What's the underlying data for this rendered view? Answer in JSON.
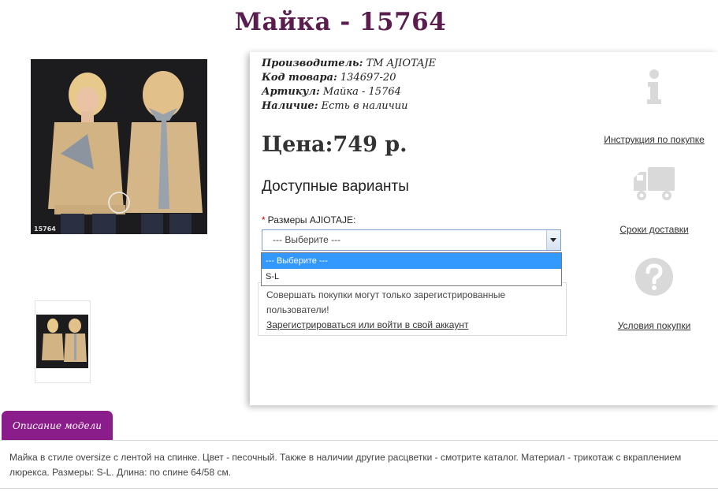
{
  "product": {
    "title": "Майка - 15764",
    "image_code": "15764",
    "meta": {
      "manufacturer_label": "Производитель:",
      "manufacturer": "ТМ AJIOTAJE",
      "code_label": "Код товара:",
      "code": "134697-20",
      "article_label": "Артикул:",
      "article": "Майка - 15764",
      "stock_label": "Наличие:",
      "stock": "Есть в наличии"
    },
    "price": "Цена:749 р.",
    "variants_title": "Доступные варианты",
    "size_label": "Размеры AJIOTAJE:",
    "size_required_mark": "*",
    "size_select_value": "--- Выберите ---",
    "size_options": [
      "--- Выберите ---",
      "S-L"
    ],
    "notice_text": "Совершать покупки могут только зарегистрированные пользователи!",
    "notice_link": "Зарегистрироваться или войти в свой аккаунт"
  },
  "sidebar": {
    "instructions_link": "Инструкция по покупке",
    "delivery_link": "Сроки доставки",
    "terms_link": "Условия покупки",
    "icons": [
      "info-icon",
      "truck-icon",
      "question-icon"
    ]
  },
  "description": {
    "tab_label": "Описание модели",
    "text": "Майка в стиле oversize с лентой на спинке. Цвет - песочный. Также в наличии другие расцветки - смотрите каталог. Материал - трикотаж с вкраплением люрекса. Размеры: S-L. Длина: по спине 64/58 см."
  },
  "colors": {
    "title": "#5a1d4e",
    "tab": "#8a1d8a",
    "highlight": "#3399ff",
    "icon_gray": "#d9d9d9"
  }
}
